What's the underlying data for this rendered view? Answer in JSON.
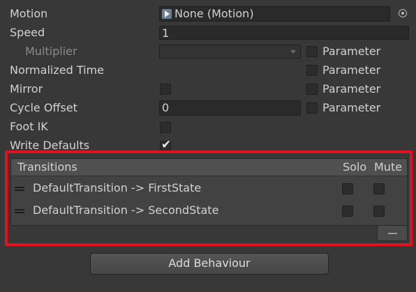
{
  "fields": {
    "motion": {
      "label": "Motion",
      "value": "None (Motion)"
    },
    "speed": {
      "label": "Speed",
      "value": "1"
    },
    "multiplier": {
      "label": "Multiplier",
      "param": "Parameter"
    },
    "normalized_time": {
      "label": "Normalized Time",
      "param": "Parameter"
    },
    "mirror": {
      "label": "Mirror",
      "param": "Parameter"
    },
    "cycle_offset": {
      "label": "Cycle Offset",
      "value": "0",
      "param": "Parameter"
    },
    "foot_ik": {
      "label": "Foot IK"
    },
    "write_defaults": {
      "label": "Write Defaults",
      "checked": true
    }
  },
  "transitions": {
    "header": "Transitions",
    "solo_label": "Solo",
    "mute_label": "Mute",
    "items": [
      {
        "name": "DefaultTransition -> FirstState"
      },
      {
        "name": "DefaultTransition -> SecondState"
      }
    ]
  },
  "add_behaviour_label": "Add Behaviour",
  "colors": {
    "highlight_border": "#e0121d",
    "background": "#383838"
  }
}
